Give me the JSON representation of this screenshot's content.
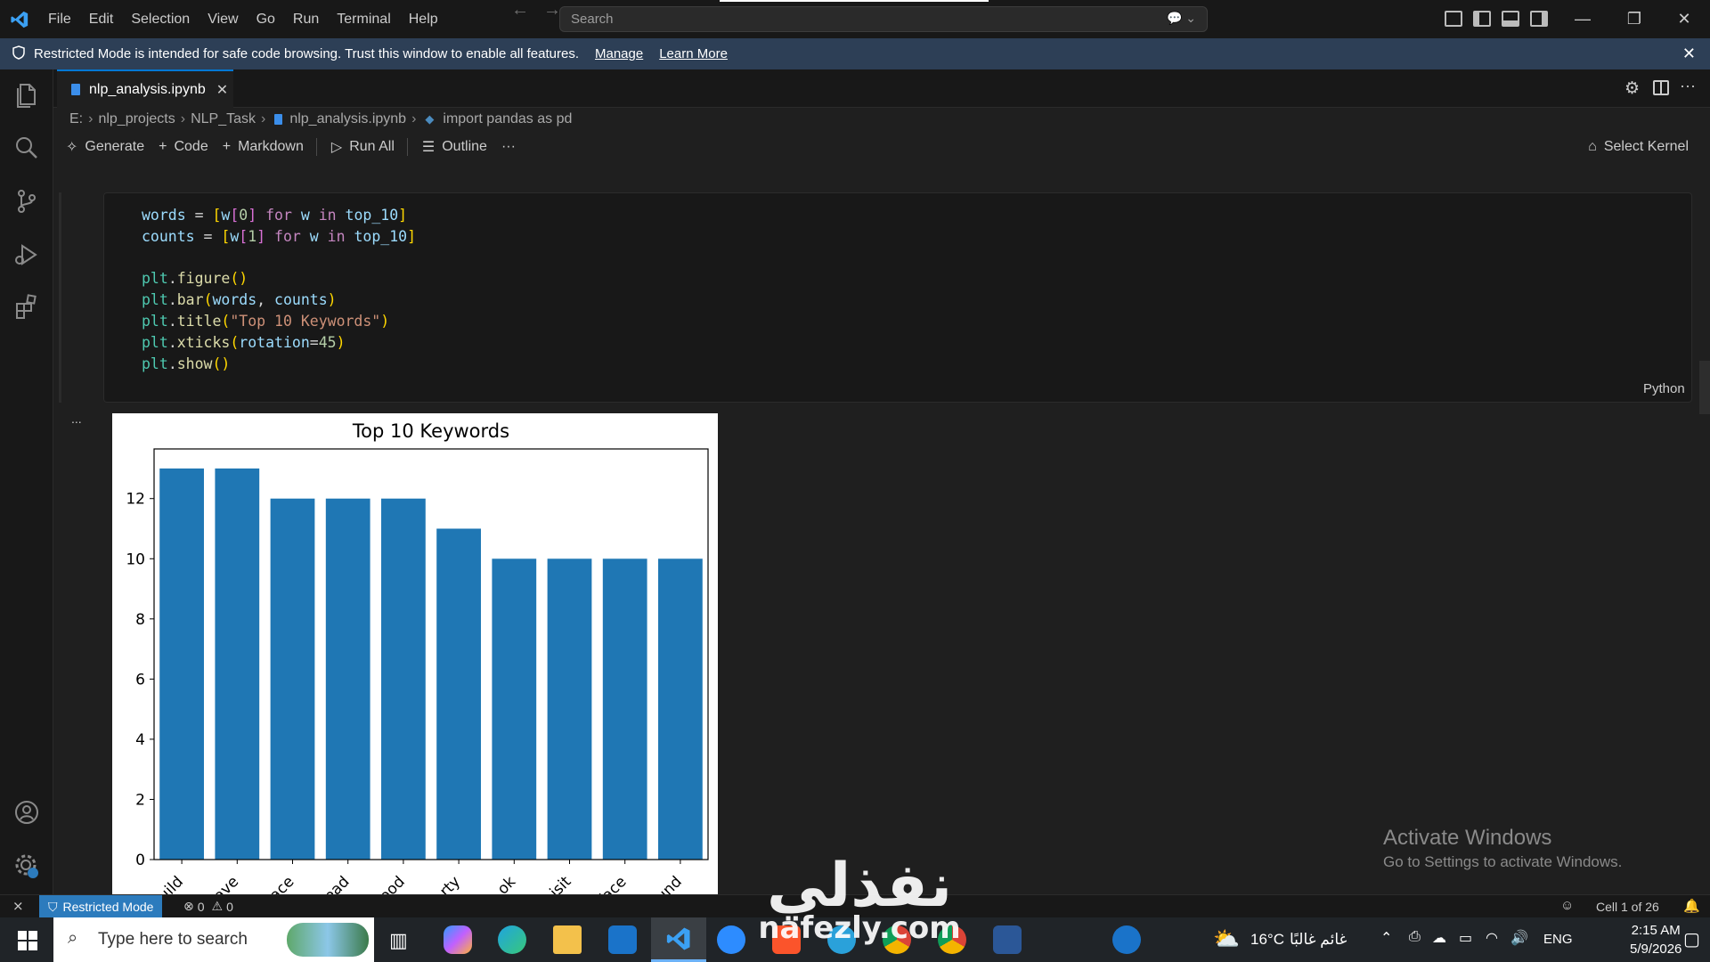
{
  "titlebar": {
    "menu": [
      "File",
      "Edit",
      "Selection",
      "View",
      "Go",
      "Run",
      "Terminal",
      "Help"
    ],
    "search_placeholder": "Search"
  },
  "banner": {
    "message": "Restricted Mode is intended for safe code browsing. Trust this window to enable all features.",
    "manage_label": "Manage",
    "learn_more_label": "Learn More"
  },
  "tab": {
    "label": "nlp_analysis.ipynb"
  },
  "breadcrumb": [
    "E:",
    "nlp_projects",
    "NLP_Task",
    "nlp_analysis.ipynb",
    "import pandas as pd"
  ],
  "toolbar": {
    "generate": "Generate",
    "code": "Code",
    "markdown": "Markdown",
    "run_all": "Run All",
    "outline": "Outline",
    "more": "···",
    "select_kernel": "Select Kernel"
  },
  "cell": {
    "language": "Python",
    "code_lines": [
      "words = [w[0] for w in top_10]",
      "counts = [w[1] for w in top_10]",
      "",
      "plt.figure()",
      "plt.bar(words, counts)",
      "plt.title(\"Top 10 Keywords\")",
      "plt.xticks(rotation=45)",
      "plt.show()"
    ],
    "output_menu": "..."
  },
  "chart_data": {
    "type": "bar",
    "title": "Top 10 Keywords",
    "categories": [
      "uild",
      "ave",
      "ace",
      "ead",
      "ood",
      "rty",
      "ok",
      "isit",
      "face",
      "und"
    ],
    "values": [
      13,
      13,
      12,
      12,
      12,
      11,
      10,
      10,
      10,
      10
    ],
    "ylim": [
      0,
      13.65
    ],
    "yticks": [
      0,
      2,
      4,
      6,
      8,
      10,
      12
    ],
    "bar_color": "#1f77b4",
    "xtick_rotation": 45,
    "grid": false
  },
  "watermark": {
    "title": "Activate Windows",
    "subtitle": "Go to Settings to activate Windows."
  },
  "statusbar": {
    "restricted": "Restricted Mode",
    "errors": "0",
    "warnings": "0",
    "cell_position": "Cell 1 of 26"
  },
  "taskbar": {
    "search_placeholder": "Type here to search",
    "weather_temp": "16°C",
    "weather_desc": "غائم غالبًا",
    "language": "ENG",
    "time": "2:15 AM",
    "date": "5/9/2026"
  },
  "brand": {
    "arabic": "نفذلي",
    "latin": "nafezly.com"
  },
  "colors": {
    "accent": "#0078d4",
    "banner": "#2d3f56",
    "status_restricted": "#2c7bbd"
  }
}
